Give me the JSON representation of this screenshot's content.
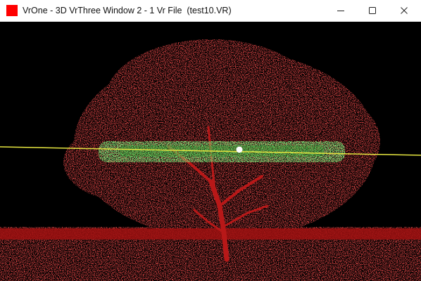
{
  "window": {
    "title": "VrOne - 3D VrThree Window 2 - 1 Vr File  (test10.VR)",
    "icon": "red-square-icon"
  },
  "caption_buttons": [
    {
      "name": "minimize",
      "icon": "minimize-icon"
    },
    {
      "name": "maximize",
      "icon": "maximize-icon"
    },
    {
      "name": "close",
      "icon": "close-icon"
    }
  ],
  "viewport": {
    "background": "#000000",
    "point_color_tree": "#b01010",
    "point_color_selected": "#2ecc2e",
    "line_color": "#e6e640",
    "cursor_color": "#ffffff"
  }
}
